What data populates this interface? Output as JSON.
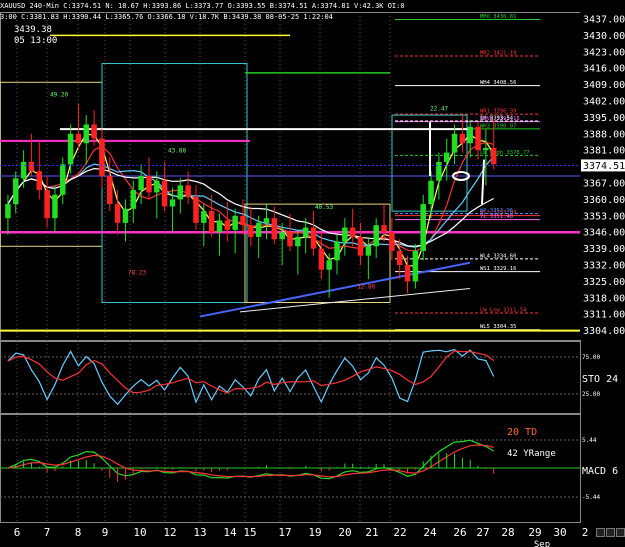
{
  "header": {
    "symbol_line": "XAUUSD 240-Min C:3374.51 N: 18.67 H:3393.86 L:3373.77 O:3393.55 B:3374.51 A:3374.81 V:42.3K OI:0",
    "info_line": "3:00 C:3381.83 H:3390.44 L:3365.76 O:3366.18 V:18.7K B:3439.38 08-05-25 1:22:04",
    "crosshair_price": "3439.38",
    "crosshair_time": "05 13:00"
  },
  "chart_data": {
    "type": "candlestick",
    "price_axis": {
      "range": [
        3300,
        3440
      ],
      "ticks": [
        "3437.00",
        "3430.00",
        "3423.00",
        "3416.00",
        "3409.00",
        "3402.00",
        "3395.00",
        "3388.00",
        "3381.00",
        "3374.51",
        "3367.00",
        "3360.00",
        "3353.00",
        "3346.00",
        "3339.00",
        "3332.00",
        "3325.00",
        "3318.00",
        "3311.00",
        "3304.00"
      ],
      "current_price": "3374.51"
    },
    "x_axis": {
      "ticks": [
        "6",
        "7",
        "8",
        "9",
        "10",
        "12",
        "13",
        "14",
        "15",
        "17",
        "19",
        "20",
        "21",
        "22",
        "24",
        "26",
        "27",
        "28",
        "29",
        "30",
        "2"
      ],
      "sublabel": "Sep"
    },
    "candles": [
      [
        3352,
        3362,
        3345,
        3358
      ],
      [
        3358,
        3372,
        3354,
        3369
      ],
      [
        3369,
        3381,
        3365,
        3376
      ],
      [
        3376,
        3388,
        3370,
        3372
      ],
      [
        3372,
        3385,
        3360,
        3364
      ],
      [
        3364,
        3370,
        3348,
        3352
      ],
      [
        3352,
        3366,
        3346,
        3362
      ],
      [
        3362,
        3378,
        3358,
        3375
      ],
      [
        3375,
        3392,
        3371,
        3388
      ],
      [
        3388,
        3401,
        3381,
        3384
      ],
      [
        3384,
        3396,
        3375,
        3392
      ],
      [
        3392,
        3398,
        3383,
        3386
      ],
      [
        3386,
        3390,
        3365,
        3370
      ],
      [
        3370,
        3378,
        3355,
        3358
      ],
      [
        3358,
        3364,
        3345,
        3350
      ],
      [
        3350,
        3360,
        3342,
        3356
      ],
      [
        3356,
        3368,
        3350,
        3364
      ],
      [
        3364,
        3375,
        3358,
        3370
      ],
      [
        3370,
        3378,
        3360,
        3363
      ],
      [
        3363,
        3372,
        3352,
        3368
      ],
      [
        3368,
        3376,
        3355,
        3357
      ],
      [
        3357,
        3365,
        3346,
        3360
      ],
      [
        3360,
        3369,
        3354,
        3366
      ],
      [
        3366,
        3372,
        3358,
        3361
      ],
      [
        3361,
        3366,
        3347,
        3350
      ],
      [
        3350,
        3358,
        3340,
        3355
      ],
      [
        3355,
        3362,
        3344,
        3346
      ],
      [
        3346,
        3354,
        3336,
        3351
      ],
      [
        3351,
        3359,
        3342,
        3347
      ],
      [
        3347,
        3356,
        3337,
        3353
      ],
      [
        3353,
        3360,
        3345,
        3349
      ],
      [
        3349,
        3357,
        3340,
        3344
      ],
      [
        3344,
        3353,
        3335,
        3350
      ],
      [
        3350,
        3358,
        3343,
        3352
      ],
      [
        3352,
        3357,
        3341,
        3343
      ],
      [
        3343,
        3350,
        3332,
        3346
      ],
      [
        3346,
        3354,
        3338,
        3340
      ],
      [
        3340,
        3347,
        3328,
        3344
      ],
      [
        3344,
        3352,
        3337,
        3348
      ],
      [
        3348,
        3355,
        3336,
        3339
      ],
      [
        3339,
        3346,
        3326,
        3330
      ],
      [
        3330,
        3337,
        3318,
        3334
      ],
      [
        3334,
        3345,
        3328,
        3342
      ],
      [
        3342,
        3352,
        3336,
        3348
      ],
      [
        3348,
        3356,
        3340,
        3344
      ],
      [
        3344,
        3350,
        3332,
        3336
      ],
      [
        3336,
        3344,
        3326,
        3340
      ],
      [
        3340,
        3352,
        3335,
        3349
      ],
      [
        3349,
        3358,
        3342,
        3346
      ],
      [
        3346,
        3352,
        3334,
        3338
      ],
      [
        3338,
        3343,
        3326,
        3332
      ],
      [
        3332,
        3336,
        3320,
        3325
      ],
      [
        3325,
        3341,
        3322,
        3338
      ],
      [
        3338,
        3362,
        3334,
        3358
      ],
      [
        3358,
        3372,
        3352,
        3368
      ],
      [
        3368,
        3380,
        3360,
        3376
      ],
      [
        3376,
        3386,
        3368,
        3380
      ],
      [
        3380,
        3392,
        3375,
        3388
      ],
      [
        3388,
        3396,
        3380,
        3384
      ],
      [
        3384,
        3394,
        3378,
        3391
      ],
      [
        3391,
        3393,
        3377,
        3381
      ],
      [
        3381,
        3390,
        3366,
        3382
      ],
      [
        3382,
        3394,
        3373,
        3375
      ]
    ],
    "levels": [
      {
        "label": "MHO 3436.81",
        "price": 3436.8,
        "color": "#22cc22"
      },
      {
        "label": "MR2 3421.19",
        "price": 3421.2,
        "color": "#ff3333"
      },
      {
        "label": "WH4 3408.56",
        "price": 3408.6,
        "color": "#ffffff"
      },
      {
        "label": "WR1 3396.39",
        "price": 3396.4,
        "color": "#ff3333"
      },
      {
        "label": "RDVR 3393.18",
        "price": 3393.2,
        "color": "#ff66ff"
      },
      {
        "label": "1H 3393.54",
        "price": 3393.5,
        "color": "#ffffff"
      },
      {
        "label": "WH3 3390.07",
        "price": 3390.1,
        "color": "#22cc22"
      },
      {
        "label": "LW High 3378.77",
        "price": 3378.8,
        "color": "#22cc22"
      },
      {
        "label": "WL3 3353.09",
        "price": 3353.1,
        "color": "#ff3333"
      },
      {
        "label": "WP 3353.96",
        "price": 3354.0,
        "color": "#4488ff"
      },
      {
        "label": "YL 3351.40",
        "price": 3351.4,
        "color": "#ff66ff"
      },
      {
        "label": "WL4 3334.60",
        "price": 3334.6,
        "color": "#ffffff"
      },
      {
        "label": "WS1 3329.16",
        "price": 3329.2,
        "color": "#ffffff"
      },
      {
        "label": "LW Low 3311.54",
        "price": 3311.5,
        "color": "#ff3333"
      },
      {
        "label": "WL5 3304.35",
        "price": 3304.4,
        "color": "#ffffff"
      }
    ],
    "annotations": [
      "49.20",
      "43.88",
      "40.53",
      "78.23",
      "32.88",
      "22.47"
    ],
    "sto": {
      "label": "STO 24",
      "ticks": [
        "75.00",
        "25.00"
      ]
    },
    "macd": {
      "label": "MACD 6",
      "ticks": [
        "5.44",
        "-5.44"
      ],
      "td_label": "20 TD",
      "yrange_label": "42 YRange"
    }
  },
  "colors": {
    "background": "#000000",
    "up": "#22dd22",
    "down": "#ff2222",
    "panel_border": "#888888"
  }
}
